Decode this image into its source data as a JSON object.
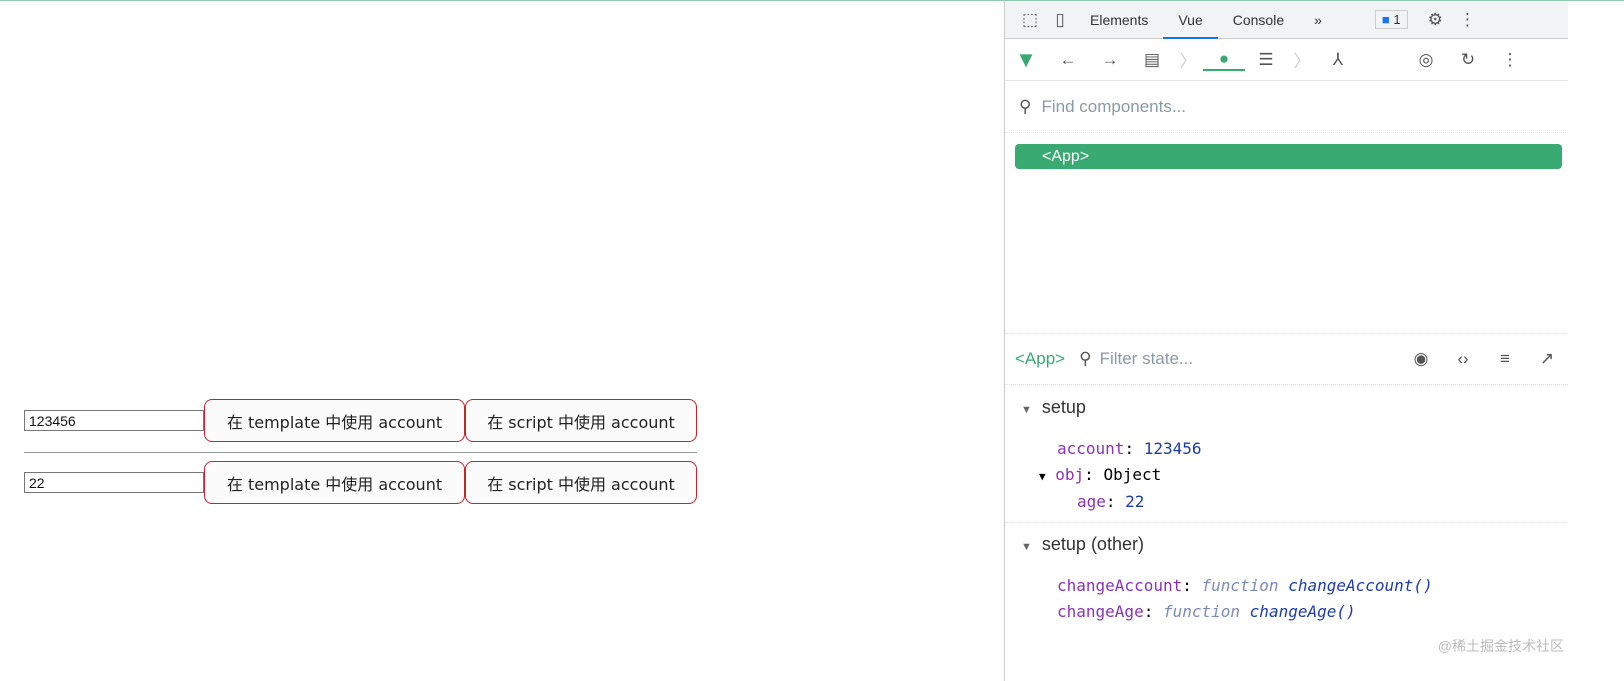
{
  "page": {
    "rows": [
      {
        "input_value": "123456",
        "btn_template": "在 template 中使用 account",
        "btn_script": "在 script 中使用 account"
      },
      {
        "input_value": "22",
        "btn_template": "在 template 中使用 account",
        "btn_script": "在 script 中使用 account"
      }
    ]
  },
  "devtools": {
    "tabs": [
      "Elements",
      "Vue",
      "Console"
    ],
    "more": "»",
    "badge": "1",
    "search_placeholder": "Find components...",
    "tree_root": "<App>",
    "selected": "<App>",
    "filter_placeholder": "Filter state...",
    "setup": {
      "title": "setup",
      "account_key": "account",
      "account_val": "123456",
      "obj_key": "obj",
      "obj_val": "Object",
      "age_key": "age",
      "age_val": "22"
    },
    "setup_other": {
      "title": "setup (other)",
      "f1_key": "changeAccount",
      "f1_kw": "function",
      "f1_name": "changeAccount()",
      "f2_key": "changeAge",
      "f2_kw": "function",
      "f2_name": "changeAge()"
    }
  },
  "watermark": "@稀土掘金技术社区",
  "colors": {
    "vue_green": "#3aaa73",
    "button_border": "#c0262d"
  }
}
